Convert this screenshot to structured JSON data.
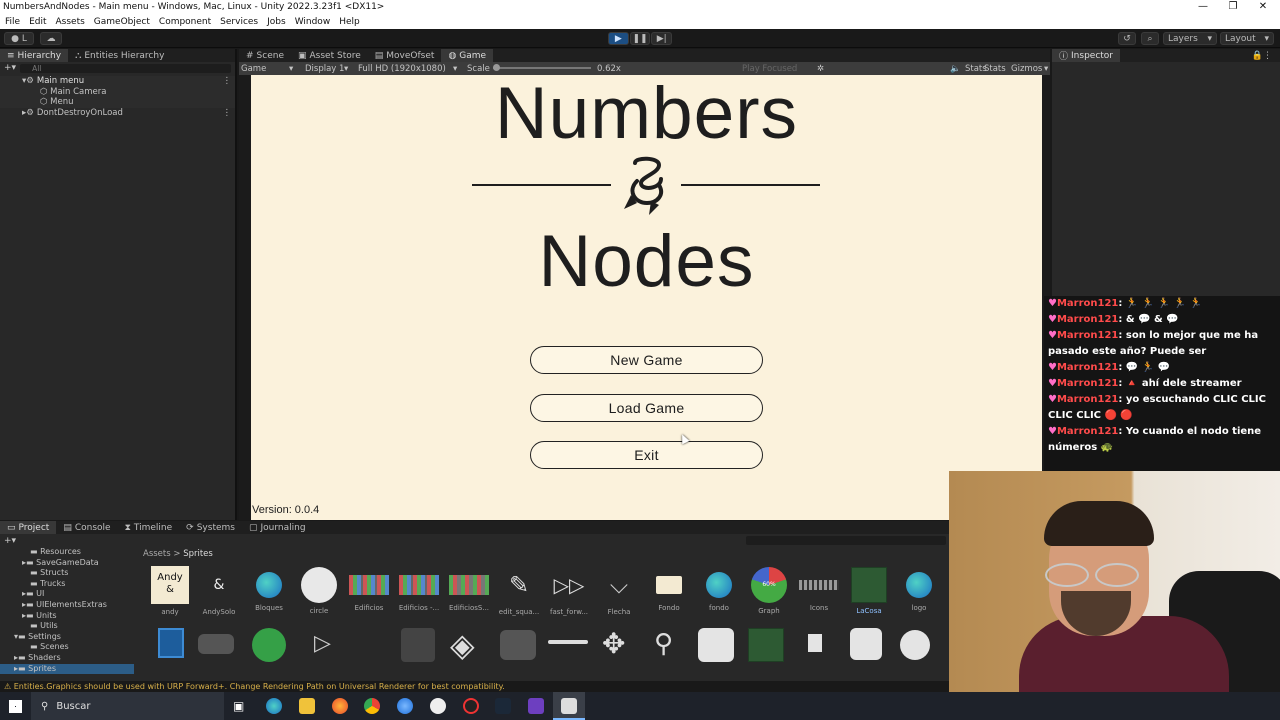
{
  "window": {
    "title": "NumbersAndNodes - Main menu - Windows, Mac, Linux - Unity 2022.3.23f1 <DX11>"
  },
  "menu": [
    "File",
    "Edit",
    "Assets",
    "GameObject",
    "Component",
    "Services",
    "Jobs",
    "Window",
    "Help"
  ],
  "toolbar": {
    "account": "L",
    "layers": "Layers",
    "layout": "Layout"
  },
  "hierarchy": {
    "tabs": [
      "Hierarchy",
      "Entities Hierarchy"
    ],
    "search_placeholder": "All",
    "items": [
      {
        "label": "Main menu",
        "indent": 1
      },
      {
        "label": "Main Camera",
        "indent": 2
      },
      {
        "label": "Menu",
        "indent": 2
      },
      {
        "label": "DontDestroyOnLoad",
        "indent": 1
      }
    ]
  },
  "center_tabs": [
    "Scene",
    "Asset Store",
    "MoveOfset",
    "Game"
  ],
  "game_bar": {
    "mode": "Game",
    "display": "Display 1",
    "resolution": "Full HD (1920x1080)",
    "scale_label": "Scale",
    "scale_value": "0.62x",
    "play_mode": "Play Focused",
    "stats": "Stats",
    "gizmos": "Gizmos"
  },
  "game": {
    "title_line1": "Numbers",
    "title_line2": "Nodes",
    "buttons": [
      "New Game",
      "Load Game",
      "Exit"
    ],
    "version": "Version: 0.0.4"
  },
  "inspector": {
    "tab": "Inspector"
  },
  "bottom_tabs": [
    "Project",
    "Console",
    "Timeline",
    "Systems",
    "Journaling"
  ],
  "project_tree": [
    "Resources",
    "SaveGameData",
    "Structs",
    "Trucks",
    "UI",
    "UIElementsExtras",
    "Units",
    "Utils",
    "Settings",
    "Scenes",
    "Shaders",
    "Sprites"
  ],
  "breadcrumb": [
    "Assets",
    "Sprites"
  ],
  "assets_row1": [
    "andy",
    "AndySolo",
    "Bloques",
    "circle",
    "Edificios",
    "Edificios -...",
    "EdificiosS...",
    "edit_squa...",
    "fast_forw...",
    "Flecha",
    "Fondo",
    "fondo",
    "Graph",
    "Icons",
    "LaCosa",
    "logo"
  ],
  "andy_thumb": "Andy\n&",
  "graph_thumb_label": "60%",
  "status_message": "Entities.Graphics should be used with URP Forward+. Change Rendering Path on Universal Renderer for best compatibility.",
  "chat": {
    "user": "Marron121",
    "messages": [
      ": 🏃 🏃 🏃 🏃 🏃",
      ": & 💬 & 💬",
      ": son lo mejor que me ha pasado este año? Puede ser",
      ": 💬 🏃 💬",
      ": 🔺 ahí dele streamer",
      ": yo escuchando CLIC CLIC CLIC CLIC 🔴 🔴",
      ": Yo cuando el nodo tiene números 🐢",
      ": 🐢"
    ]
  },
  "taskbar": {
    "search": "Buscar"
  },
  "colors": {
    "game_bg": "#fbf2dc",
    "chat_user": "#ff4b4b",
    "unity_dark": "#191919"
  }
}
